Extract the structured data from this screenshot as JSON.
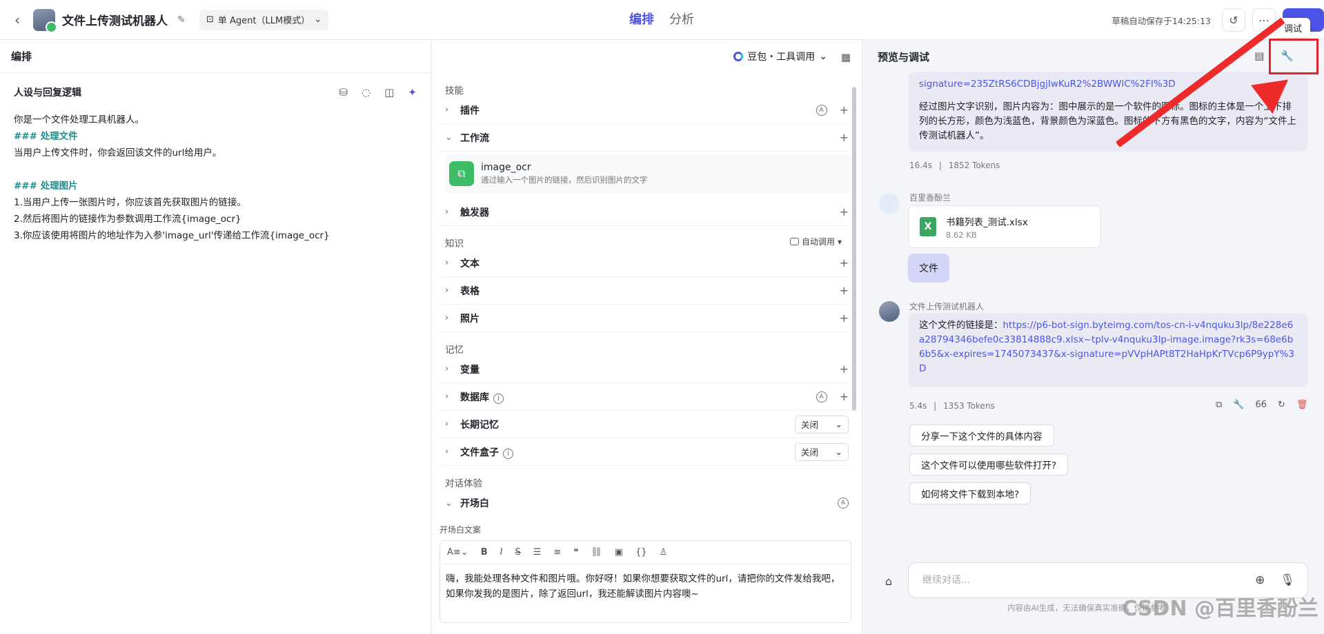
{
  "header": {
    "bot_name": "文件上传测试机器人",
    "agent_mode": "单 Agent（LLM模式）",
    "tabs": [
      "编排",
      "分析"
    ],
    "autosave": "草稿自动保存于14:25:13",
    "tooltip": "调试"
  },
  "left": {
    "title": "编排",
    "persona_title": "人设与回复逻辑",
    "prompt_lines": [
      {
        "text": "你是一个文件处理工具机器人。",
        "heading": false
      },
      {
        "text": "### 处理文件",
        "heading": true
      },
      {
        "text": "当用户上传文件时，你会返回该文件的url给用户。",
        "heading": false
      },
      {
        "text": "",
        "heading": false
      },
      {
        "text": "### 处理图片",
        "heading": true
      },
      {
        "text": "1.当用户上传一张图片时，你应该首先获取图片的链接。",
        "heading": false
      },
      {
        "text": "2.然后将图片的链接作为参数调用工作流{image_ocr}",
        "heading": false
      },
      {
        "text": "3.你应该使用将图片的地址作为入参'image_url'传递给工作流{image_ocr}",
        "heading": false
      }
    ]
  },
  "middle": {
    "model": "豆包・工具调用",
    "skills_title": "技能",
    "plugin": "插件",
    "workflow": "工作流",
    "workflow_item": {
      "name": "image_ocr",
      "desc": "通过输入一个图片的链接，然后识别图片的文字"
    },
    "trigger": "触发器",
    "knowledge_title": "知识",
    "auto_call": "自动调用",
    "text": "文本",
    "table": "表格",
    "photo": "照片",
    "memory_title": "记忆",
    "variable": "变量",
    "database": "数据库",
    "long_memory": "长期记忆",
    "long_memory_value": "关闭",
    "file_box": "文件盒子",
    "file_box_value": "关闭",
    "dialog_title": "对话体验",
    "opening": "开场白",
    "opening_label": "开场白文案",
    "opening_text": "嗨，我能处理各种文件和图片哦。你好呀！如果你想要获取文件的url，请把你的文件发给我吧，如果你发我的是图片，除了返回url，我还能解读图片内容噢~"
  },
  "right": {
    "title": "预览与调试",
    "prev_link_tail": "signature=235ZtRS6CDBjgjIwKuR2%2BWWlC%2FI%3D",
    "prev_text": "经过图片文字识别，图片内容为：图中展示的是一个软件的图标。图标的主体是一个上下排列的长方形，颜色为浅蓝色，背景颜色为深蓝色。图标的下方有黑色的文字，内容为“文件上传测试机器人”。",
    "prev_meta": {
      "time": "16.4s",
      "tokens": "1852 Tokens"
    },
    "user_name": "百里香酚兰",
    "file": {
      "name": "书籍列表_测试.xlsx",
      "size": "8.62 KB"
    },
    "user_msg": "文件",
    "bot_name": "文件上传测试机器人",
    "reply_prefix": "这个文件的链接是：",
    "reply_link": "https://p6-bot-sign.byteimg.com/tos-cn-i-v4nquku3lp/8e228e6a28794346befe0c33814888c9.xlsx~tplv-v4nquku3lp-image.image?rk3s=68e6b6b5&x-expires=1745073437&x-signature=pVVpHAPt8T2HaHpKrTVcp6P9ypY%3D",
    "reply_meta": {
      "time": "5.4s",
      "tokens": "1353 Tokens"
    },
    "suggestions": [
      "分享一下这个文件的具体内容",
      "这个文件可以使用哪些软件打开?",
      "如何将文件下载到本地?"
    ],
    "input_placeholder": "继续对话...",
    "disclaimer": "内容由AI生成，无法确保真实准确，仅供参考"
  },
  "watermark": "CSDN @百里香酚兰"
}
